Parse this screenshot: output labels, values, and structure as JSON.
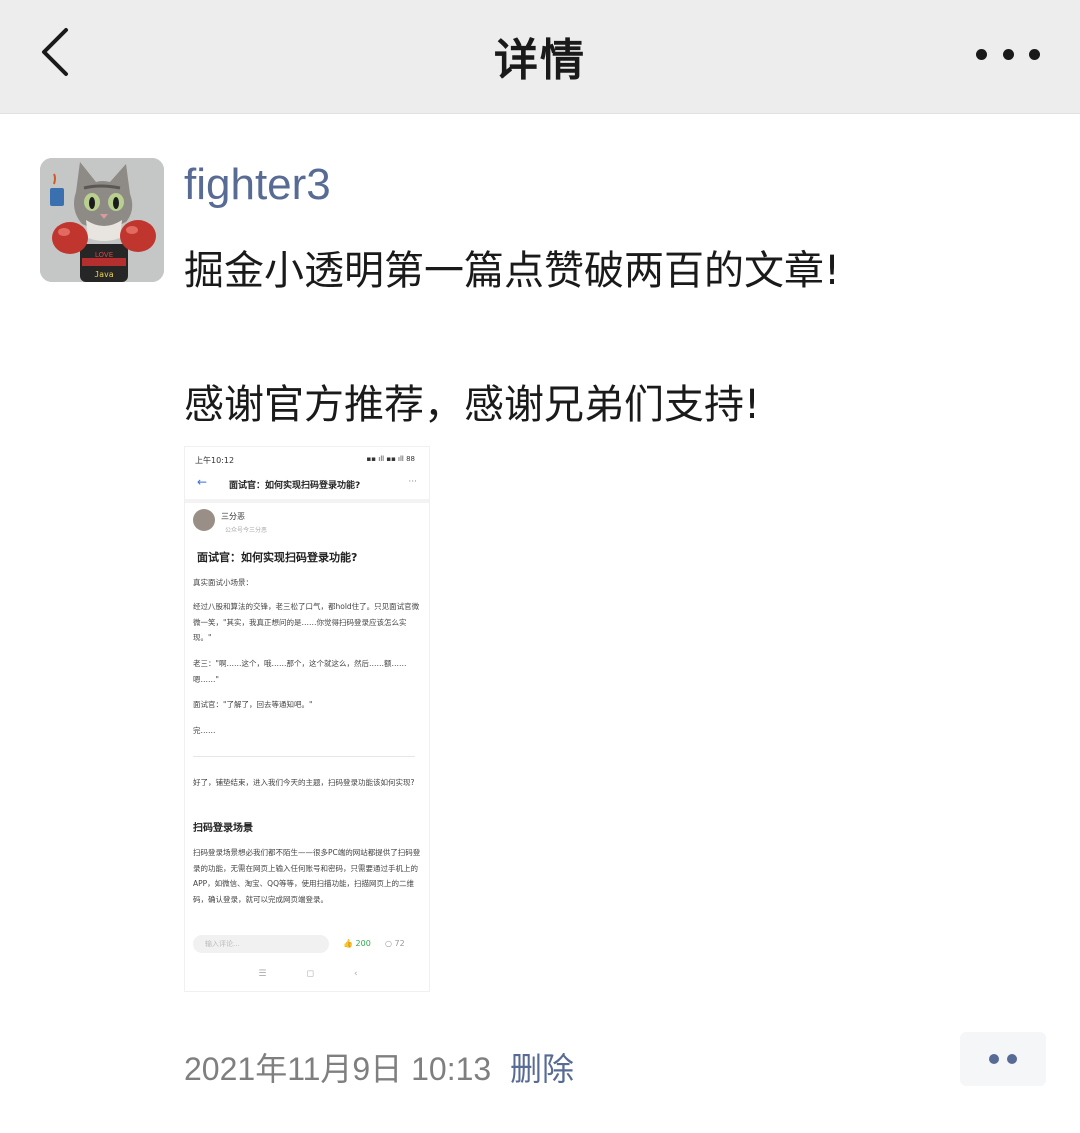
{
  "header": {
    "title": "详情",
    "back_icon": "chevron-left-icon",
    "more_icon": "more-horizontal-icon"
  },
  "post": {
    "username": "fighter3",
    "text_line1": "掘金小透明第一篇点赞破两百的文章!",
    "text_line2": "感谢官方推荐，感谢兄弟们支持!",
    "avatar_text_top": "LOVE",
    "avatar_text_bottom": "Java"
  },
  "attachment": {
    "status_time": "上午10:12",
    "status_icons": "▪▪ ıll ▪▪ ıll 88",
    "page_title": "面试官：如何实现扫码登录功能?",
    "author": "三分恶",
    "author_sub": "公众号今三分恶",
    "article_title": "面试官：如何实现扫码登录功能?",
    "para1": "真实面试小场景：",
    "para2": "经过八股和算法的交锋，老三松了口气，都hold住了。只见面试官微微一笑，\"其实，我真正想问的是……你觉得扫码登录应该怎么实现。\"",
    "para3": "老三：\"啊……这个，哦……那个，这个就这么，然后……额……嗯……\"",
    "para4": "面试官：\"了解了，回去等通知吧。\"",
    "para5": "完……",
    "para6": "好了，铺垫结束，进入我们今天的主题，扫码登录功能该如何实现?",
    "subhead": "扫码登录场景",
    "para7": "扫码登录场景想必我们都不陌生——很多PC端的网站都提供了扫码登录的功能，无需在网页上输入任何账号和密码，只需要通过手机上的APP，如微信、淘宝、QQ等等，使用扫描功能，扫描网页上的二维码，确认登录，就可以完成网页端登录。",
    "comment_placeholder": "输入评论...",
    "like_count": "200",
    "comment_count": "72",
    "nav_menu": "☰",
    "nav_home": "◻",
    "nav_back": "‹"
  },
  "footer": {
    "timestamp": "2021年11月9日 10:13",
    "delete_label": "删除"
  },
  "colors": {
    "link": "#576b95",
    "header_bg": "#ededed",
    "timestamp": "#7f7f7f"
  }
}
